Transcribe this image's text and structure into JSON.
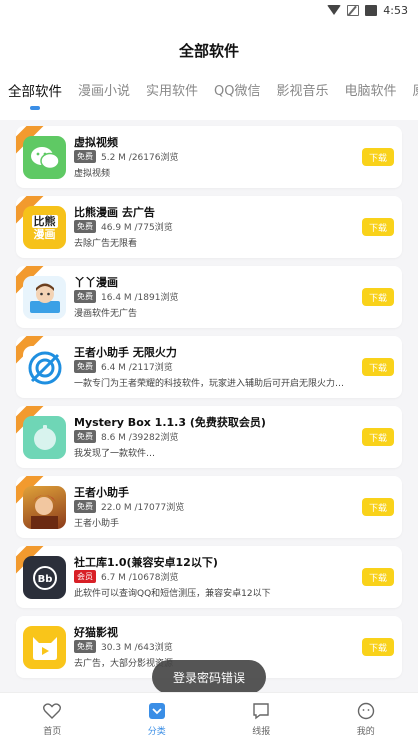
{
  "status": {
    "time": "4:53"
  },
  "header": {
    "title": "全部软件"
  },
  "tabs": [
    "全部软件",
    "漫画小说",
    "实用软件",
    "QQ微信",
    "影视音乐",
    "电脑软件",
    "原创软件"
  ],
  "apps": [
    {
      "name": "虚拟视频",
      "badge": "免费",
      "badge_color": "#666666",
      "stats": "5.2 M /26176浏览",
      "desc": "虚拟视频",
      "icon": "wechat-style-icon"
    },
    {
      "name": "比熊漫画 去广告",
      "badge": "免费",
      "badge_color": "#666666",
      "stats": "46.9 M /775浏览",
      "desc": "去除广告无限看",
      "icon": "bixiong-manhua-icon"
    },
    {
      "name": "丫丫漫画",
      "badge": "免费",
      "badge_color": "#666666",
      "stats": "16.4 M /1891浏览",
      "desc": "漫画软件无广告",
      "icon": "yaya-manhua-icon"
    },
    {
      "name": "王者小助手 无限火力",
      "badge": "免费",
      "badge_color": "#666666",
      "stats": "6.4 M /2117浏览",
      "desc": "一款专门为王者荣耀的科技软件，玩家进入辅助后可开启无限火力…",
      "icon": "target-icon"
    },
    {
      "name": "Mystery Box 1.1.3 (免费获取会员)",
      "badge": "免费",
      "badge_color": "#666666",
      "stats": "8.6 M /39282浏览",
      "desc": "我发现了一款软件…",
      "icon": "bubble-icon"
    },
    {
      "name": "王者小助手",
      "badge": "免费",
      "badge_color": "#666666",
      "stats": "22.0 M /17077浏览",
      "desc": "王者小助手",
      "icon": "hero-portrait-icon"
    },
    {
      "name": "社工库1.0(兼容安卓12以下)",
      "badge": "会员",
      "badge_color": "#d81f26",
      "stats": "6.7 M /10678浏览",
      "desc": "此软件可以查询QQ和短信测压，兼容安卓12以下",
      "icon": "bb-icon"
    },
    {
      "name": "好猫影视",
      "badge": "免费",
      "badge_color": "#666666",
      "stats": "30.3 M /643浏览",
      "desc": "去广告，大部分影视资源",
      "icon": "cat-icon"
    }
  ],
  "download_label": "下载",
  "toast": "登录密码错误",
  "bottom_nav": [
    {
      "label": "首页",
      "icon": "heart-icon",
      "active": false
    },
    {
      "label": "分类",
      "icon": "category-icon",
      "active": true
    },
    {
      "label": "线报",
      "icon": "message-icon",
      "active": false
    },
    {
      "label": "我的",
      "icon": "smile-icon",
      "active": false
    }
  ],
  "colors": {
    "accent": "#3a8ee6",
    "download": "#f9d21a",
    "ribbon": "#f29a2e"
  }
}
